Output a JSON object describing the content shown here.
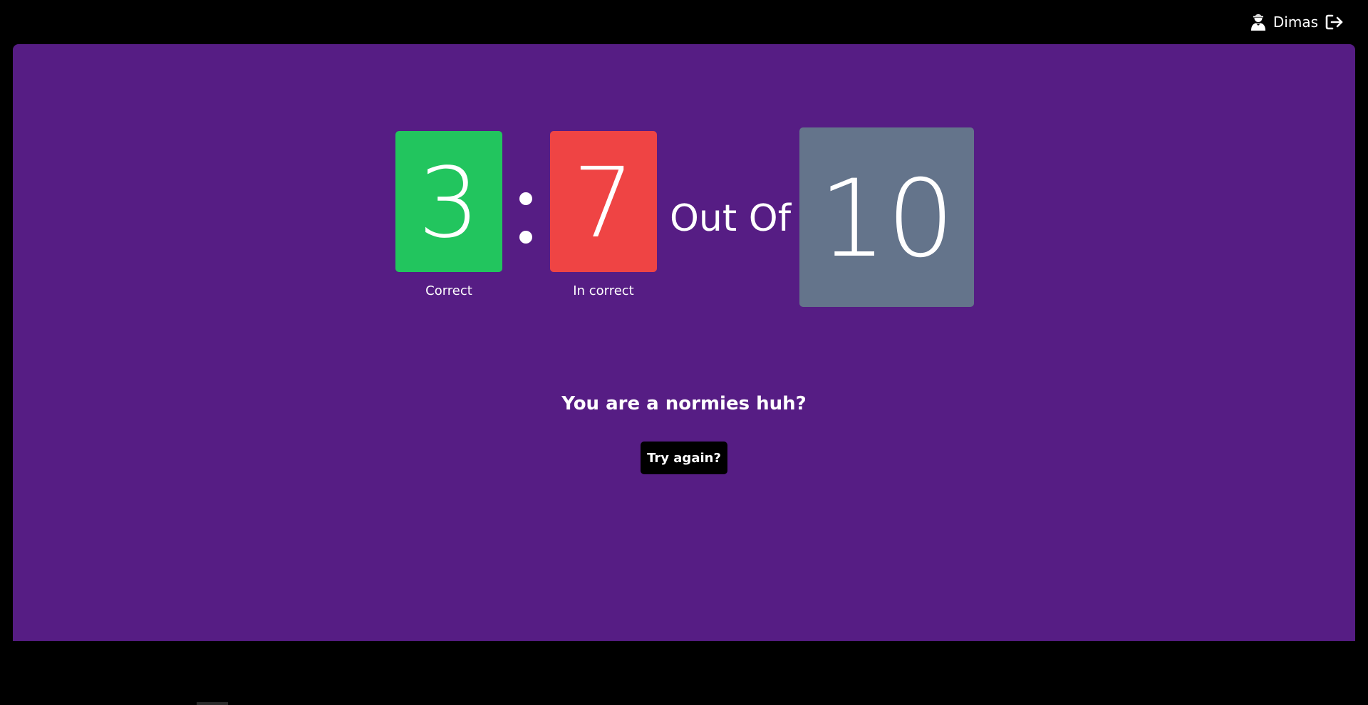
{
  "header": {
    "user_icon": "user-icon",
    "user_name": "Dimas",
    "logout_icon": "logout-icon"
  },
  "score": {
    "correct": "3",
    "correct_label": "Correct",
    "separator": ":",
    "incorrect": "7",
    "incorrect_label": "In correct",
    "out_of_label": "Out Of",
    "total": "10"
  },
  "result": {
    "message": "You are a normies huh?",
    "try_again_label": "Try again?"
  },
  "colors": {
    "page_background": "#000000",
    "panel_background": "#561d84",
    "correct_tile": "#22c55e",
    "incorrect_tile": "#ef4444",
    "total_tile": "#64748b",
    "button_background": "#000000",
    "text": "#ffffff"
  }
}
